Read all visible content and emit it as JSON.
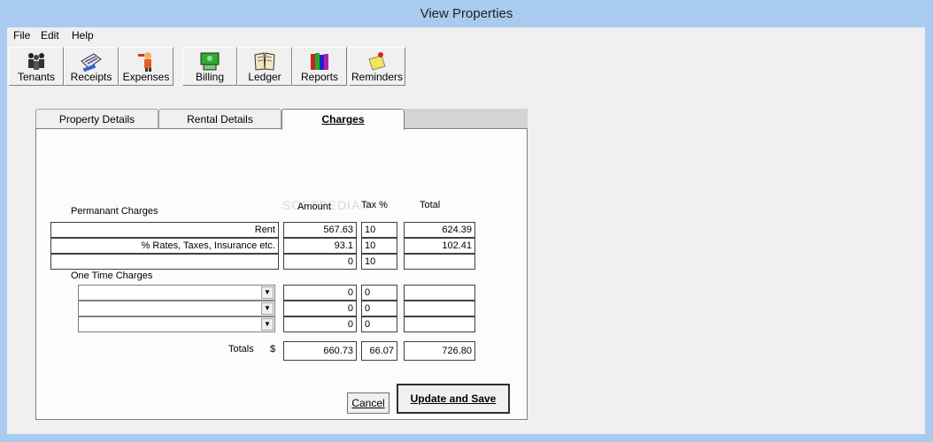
{
  "window": {
    "title": "View Properties"
  },
  "menu": {
    "file": "File",
    "edit": "Edit",
    "help": "Help"
  },
  "toolbar": {
    "tenants": "Tenants",
    "receipts": "Receipts",
    "expenses": "Expenses",
    "billing": "Billing",
    "ledger": "Ledger",
    "reports": "Reports",
    "reminders": "Reminders"
  },
  "tabs": {
    "property_details": "Property Details",
    "rental_details": "Rental Details",
    "charges": "Charges"
  },
  "charges": {
    "permanent_label": "Permanant Charges",
    "one_time_label": "One Time Charges",
    "col_amount": "Amount",
    "col_tax": "Tax %",
    "col_total": "Total",
    "watermark": "SOFTPEDIA®",
    "permanent": [
      {
        "desc": "Rent",
        "amount": "567.63",
        "tax": "10",
        "total": "624.39"
      },
      {
        "desc": "% Rates, Taxes, Insurance etc.",
        "amount": "93.1",
        "tax": "10",
        "total": "102.41"
      },
      {
        "desc": "",
        "amount": "0",
        "tax": "10",
        "total": ""
      }
    ],
    "one_time": [
      {
        "desc": "",
        "amount": "0",
        "tax": "0",
        "total": ""
      },
      {
        "desc": "",
        "amount": "0",
        "tax": "0",
        "total": ""
      },
      {
        "desc": "",
        "amount": "0",
        "tax": "0",
        "total": ""
      }
    ],
    "totals_label": "Totals",
    "currency": "$",
    "totals": {
      "amount": "660.73",
      "tax": "66.07",
      "total": "726.80"
    },
    "cancel_label": "Cancel",
    "update_label": "Update and Save"
  }
}
